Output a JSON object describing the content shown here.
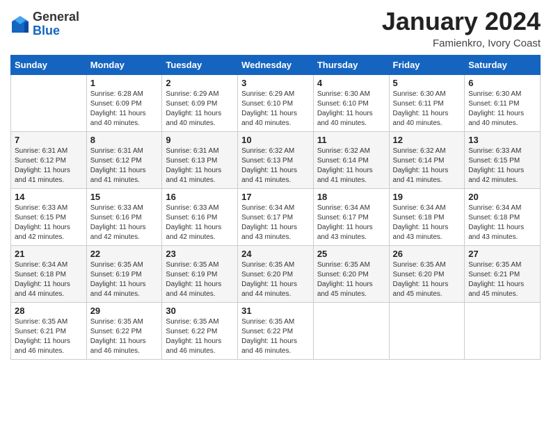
{
  "logo": {
    "general": "General",
    "blue": "Blue"
  },
  "header": {
    "month_year": "January 2024",
    "subtitle": "Famienkro, Ivory Coast"
  },
  "weekdays": [
    "Sunday",
    "Monday",
    "Tuesday",
    "Wednesday",
    "Thursday",
    "Friday",
    "Saturday"
  ],
  "weeks": [
    {
      "shaded": false,
      "days": [
        {
          "num": "",
          "info": ""
        },
        {
          "num": "1",
          "info": "Sunrise: 6:28 AM\nSunset: 6:09 PM\nDaylight: 11 hours\nand 40 minutes."
        },
        {
          "num": "2",
          "info": "Sunrise: 6:29 AM\nSunset: 6:09 PM\nDaylight: 11 hours\nand 40 minutes."
        },
        {
          "num": "3",
          "info": "Sunrise: 6:29 AM\nSunset: 6:10 PM\nDaylight: 11 hours\nand 40 minutes."
        },
        {
          "num": "4",
          "info": "Sunrise: 6:30 AM\nSunset: 6:10 PM\nDaylight: 11 hours\nand 40 minutes."
        },
        {
          "num": "5",
          "info": "Sunrise: 6:30 AM\nSunset: 6:11 PM\nDaylight: 11 hours\nand 40 minutes."
        },
        {
          "num": "6",
          "info": "Sunrise: 6:30 AM\nSunset: 6:11 PM\nDaylight: 11 hours\nand 40 minutes."
        }
      ]
    },
    {
      "shaded": true,
      "days": [
        {
          "num": "7",
          "info": "Sunrise: 6:31 AM\nSunset: 6:12 PM\nDaylight: 11 hours\nand 41 minutes."
        },
        {
          "num": "8",
          "info": "Sunrise: 6:31 AM\nSunset: 6:12 PM\nDaylight: 11 hours\nand 41 minutes."
        },
        {
          "num": "9",
          "info": "Sunrise: 6:31 AM\nSunset: 6:13 PM\nDaylight: 11 hours\nand 41 minutes."
        },
        {
          "num": "10",
          "info": "Sunrise: 6:32 AM\nSunset: 6:13 PM\nDaylight: 11 hours\nand 41 minutes."
        },
        {
          "num": "11",
          "info": "Sunrise: 6:32 AM\nSunset: 6:14 PM\nDaylight: 11 hours\nand 41 minutes."
        },
        {
          "num": "12",
          "info": "Sunrise: 6:32 AM\nSunset: 6:14 PM\nDaylight: 11 hours\nand 41 minutes."
        },
        {
          "num": "13",
          "info": "Sunrise: 6:33 AM\nSunset: 6:15 PM\nDaylight: 11 hours\nand 42 minutes."
        }
      ]
    },
    {
      "shaded": false,
      "days": [
        {
          "num": "14",
          "info": "Sunrise: 6:33 AM\nSunset: 6:15 PM\nDaylight: 11 hours\nand 42 minutes."
        },
        {
          "num": "15",
          "info": "Sunrise: 6:33 AM\nSunset: 6:16 PM\nDaylight: 11 hours\nand 42 minutes."
        },
        {
          "num": "16",
          "info": "Sunrise: 6:33 AM\nSunset: 6:16 PM\nDaylight: 11 hours\nand 42 minutes."
        },
        {
          "num": "17",
          "info": "Sunrise: 6:34 AM\nSunset: 6:17 PM\nDaylight: 11 hours\nand 43 minutes."
        },
        {
          "num": "18",
          "info": "Sunrise: 6:34 AM\nSunset: 6:17 PM\nDaylight: 11 hours\nand 43 minutes."
        },
        {
          "num": "19",
          "info": "Sunrise: 6:34 AM\nSunset: 6:18 PM\nDaylight: 11 hours\nand 43 minutes."
        },
        {
          "num": "20",
          "info": "Sunrise: 6:34 AM\nSunset: 6:18 PM\nDaylight: 11 hours\nand 43 minutes."
        }
      ]
    },
    {
      "shaded": true,
      "days": [
        {
          "num": "21",
          "info": "Sunrise: 6:34 AM\nSunset: 6:18 PM\nDaylight: 11 hours\nand 44 minutes."
        },
        {
          "num": "22",
          "info": "Sunrise: 6:35 AM\nSunset: 6:19 PM\nDaylight: 11 hours\nand 44 minutes."
        },
        {
          "num": "23",
          "info": "Sunrise: 6:35 AM\nSunset: 6:19 PM\nDaylight: 11 hours\nand 44 minutes."
        },
        {
          "num": "24",
          "info": "Sunrise: 6:35 AM\nSunset: 6:20 PM\nDaylight: 11 hours\nand 44 minutes."
        },
        {
          "num": "25",
          "info": "Sunrise: 6:35 AM\nSunset: 6:20 PM\nDaylight: 11 hours\nand 45 minutes."
        },
        {
          "num": "26",
          "info": "Sunrise: 6:35 AM\nSunset: 6:20 PM\nDaylight: 11 hours\nand 45 minutes."
        },
        {
          "num": "27",
          "info": "Sunrise: 6:35 AM\nSunset: 6:21 PM\nDaylight: 11 hours\nand 45 minutes."
        }
      ]
    },
    {
      "shaded": false,
      "days": [
        {
          "num": "28",
          "info": "Sunrise: 6:35 AM\nSunset: 6:21 PM\nDaylight: 11 hours\nand 46 minutes."
        },
        {
          "num": "29",
          "info": "Sunrise: 6:35 AM\nSunset: 6:22 PM\nDaylight: 11 hours\nand 46 minutes."
        },
        {
          "num": "30",
          "info": "Sunrise: 6:35 AM\nSunset: 6:22 PM\nDaylight: 11 hours\nand 46 minutes."
        },
        {
          "num": "31",
          "info": "Sunrise: 6:35 AM\nSunset: 6:22 PM\nDaylight: 11 hours\nand 46 minutes."
        },
        {
          "num": "",
          "info": ""
        },
        {
          "num": "",
          "info": ""
        },
        {
          "num": "",
          "info": ""
        }
      ]
    }
  ]
}
